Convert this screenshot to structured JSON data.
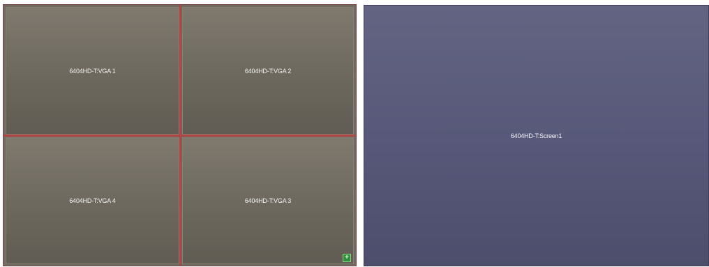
{
  "video_wall": {
    "tiles": [
      {
        "label": "6404HD-T:VGA 1"
      },
      {
        "label": "6404HD-T:VGA 2"
      },
      {
        "label": "6404HD-T:VGA 4"
      },
      {
        "label": "6404HD-T:VGA 3"
      }
    ],
    "corner_button_icon": "plus-square-icon",
    "corner_button_symbol": "+"
  },
  "screen_panel": {
    "label": "6404HD-T:Screen1"
  },
  "colors": {
    "divider": "#b04545",
    "tile_bg": "#6e6a61",
    "screen_bg": "#58597a",
    "button_green": "#2f8f3a"
  }
}
